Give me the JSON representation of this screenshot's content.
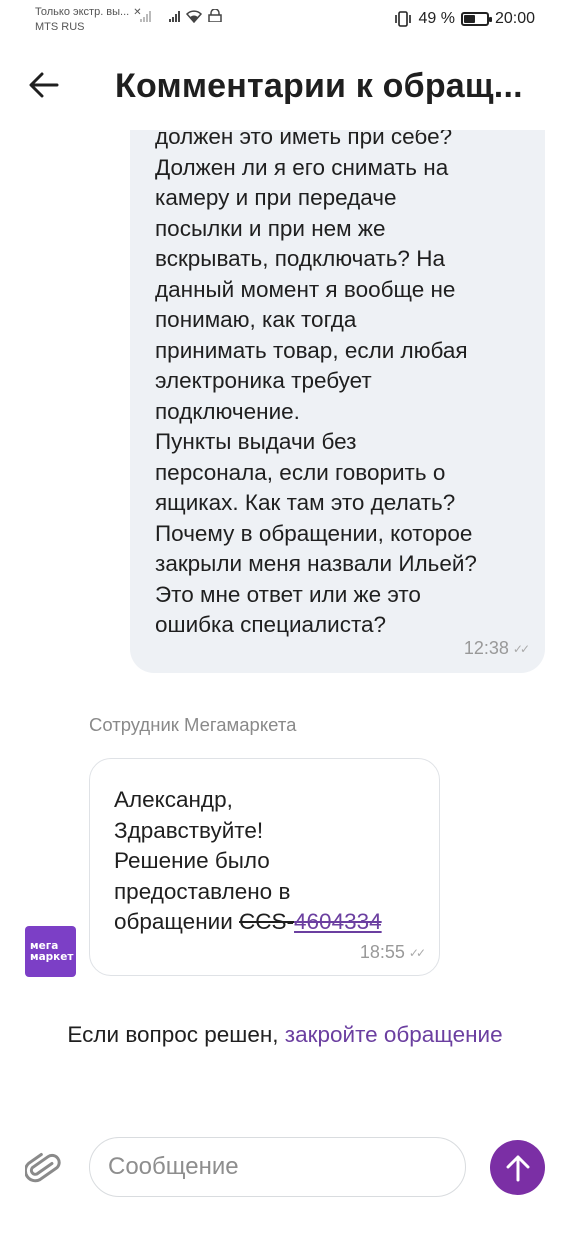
{
  "status_bar": {
    "carrier_line1": "Только экстр. вы...",
    "carrier_line2": "MTS RUS",
    "battery_percent": "49 %",
    "battery_level": 0.49,
    "time": "20:00"
  },
  "header": {
    "back_icon": "arrow-left-icon",
    "title": "Комментарии к обращ..."
  },
  "messages": {
    "user_message": {
      "text": "должен это иметь при себе?\nДолжен ли я его снимать на\nкамеру и при передаче\nпосылки и при нем же\nвскрывать, подключать? На\nданный момент я вообще не\nпонимаю, как тогда\nпринимать товар, если любая\nэлектроника требует\nподключение.\nПункты выдачи без\nперсонала, если говорить о\nящиках. Как там это делать?\nПочему в обращении, которое\nзакрыли меня назвали Ильей?\nЭто мне ответ или же это\nошибка специалиста?",
      "time": "12:38"
    },
    "staff_label": "Сотрудник Мегамаркета",
    "staff_message": {
      "lines": [
        "Александр,",
        "Здравствуйте!",
        "Решение было",
        "предоставлено в"
      ],
      "last_line_prefix": "обращении",
      "ticket_prefix": "CCS-",
      "ticket_number": "4604334",
      "time": "18:55"
    },
    "avatar": {
      "line1": "мега",
      "line2": "маркет"
    },
    "resolve_note": {
      "text": "Если вопрос решен, ",
      "link": "закройте обращение"
    }
  },
  "composer": {
    "attach_icon": "paperclip-icon",
    "placeholder": "Сообщение",
    "send_icon": "arrow-up-icon"
  },
  "colors": {
    "accent": "#7b2fa5",
    "link": "#6b3fa0",
    "bubble_bg": "#eef1f5"
  }
}
